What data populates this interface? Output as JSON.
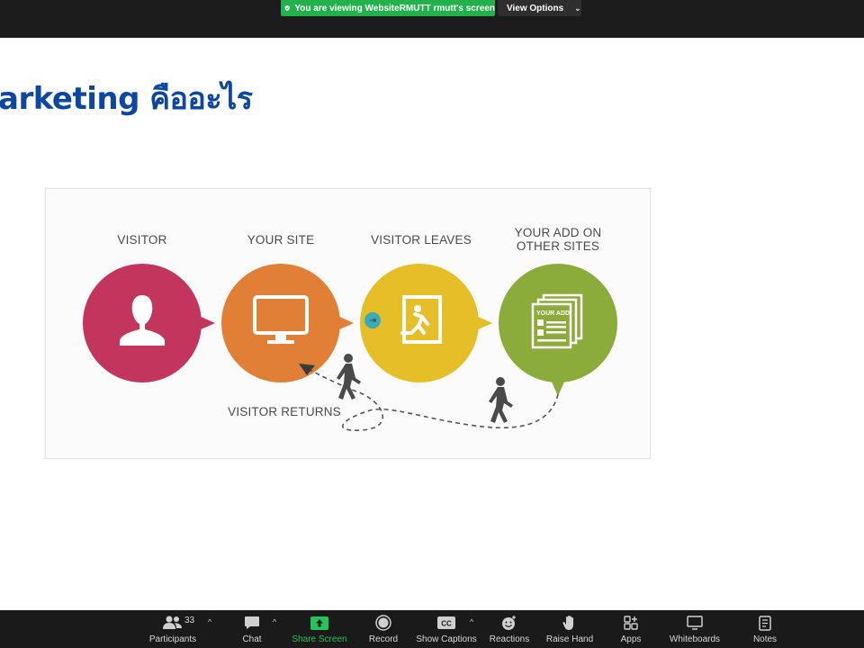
{
  "banner": {
    "viewing_text": "You are viewing WebsiteRMUTT rmutt's screen",
    "view_options_label": "View Options"
  },
  "slide": {
    "title": "arketing คืออะไร",
    "diagram": {
      "steps": [
        {
          "label": "VISITOR",
          "color": "#c2365e",
          "icon": "person-icon"
        },
        {
          "label": "YOUR SITE",
          "color": "#e27f36",
          "icon": "monitor-icon"
        },
        {
          "label": "VISITOR LEAVES",
          "color": "#e6be28",
          "icon": "exit-sign-icon"
        },
        {
          "label_line1": "YOUR ADD ON",
          "label_line2": "OTHER SITES",
          "color": "#8bab3a",
          "icon": "ad-pages-icon",
          "inner_text": "YOUR ADD"
        }
      ],
      "returns_label": "VISITOR RETURNS"
    }
  },
  "toolbar": {
    "participants": {
      "label": "Participants",
      "count": "33"
    },
    "chat": {
      "label": "Chat"
    },
    "share_screen": {
      "label": "Share Screen"
    },
    "record": {
      "label": "Record"
    },
    "show_captions": {
      "label": "Show Captions",
      "icon_text": "CC"
    },
    "reactions": {
      "label": "Reactions"
    },
    "raise_hand": {
      "label": "Raise Hand"
    },
    "apps": {
      "label": "Apps"
    },
    "whiteboards": {
      "label": "Whiteboards"
    },
    "notes": {
      "label": "Notes"
    }
  },
  "colors": {
    "banner_green": "#22b14c",
    "title_blue": "#0d47a1",
    "share_green": "#24c55b"
  }
}
